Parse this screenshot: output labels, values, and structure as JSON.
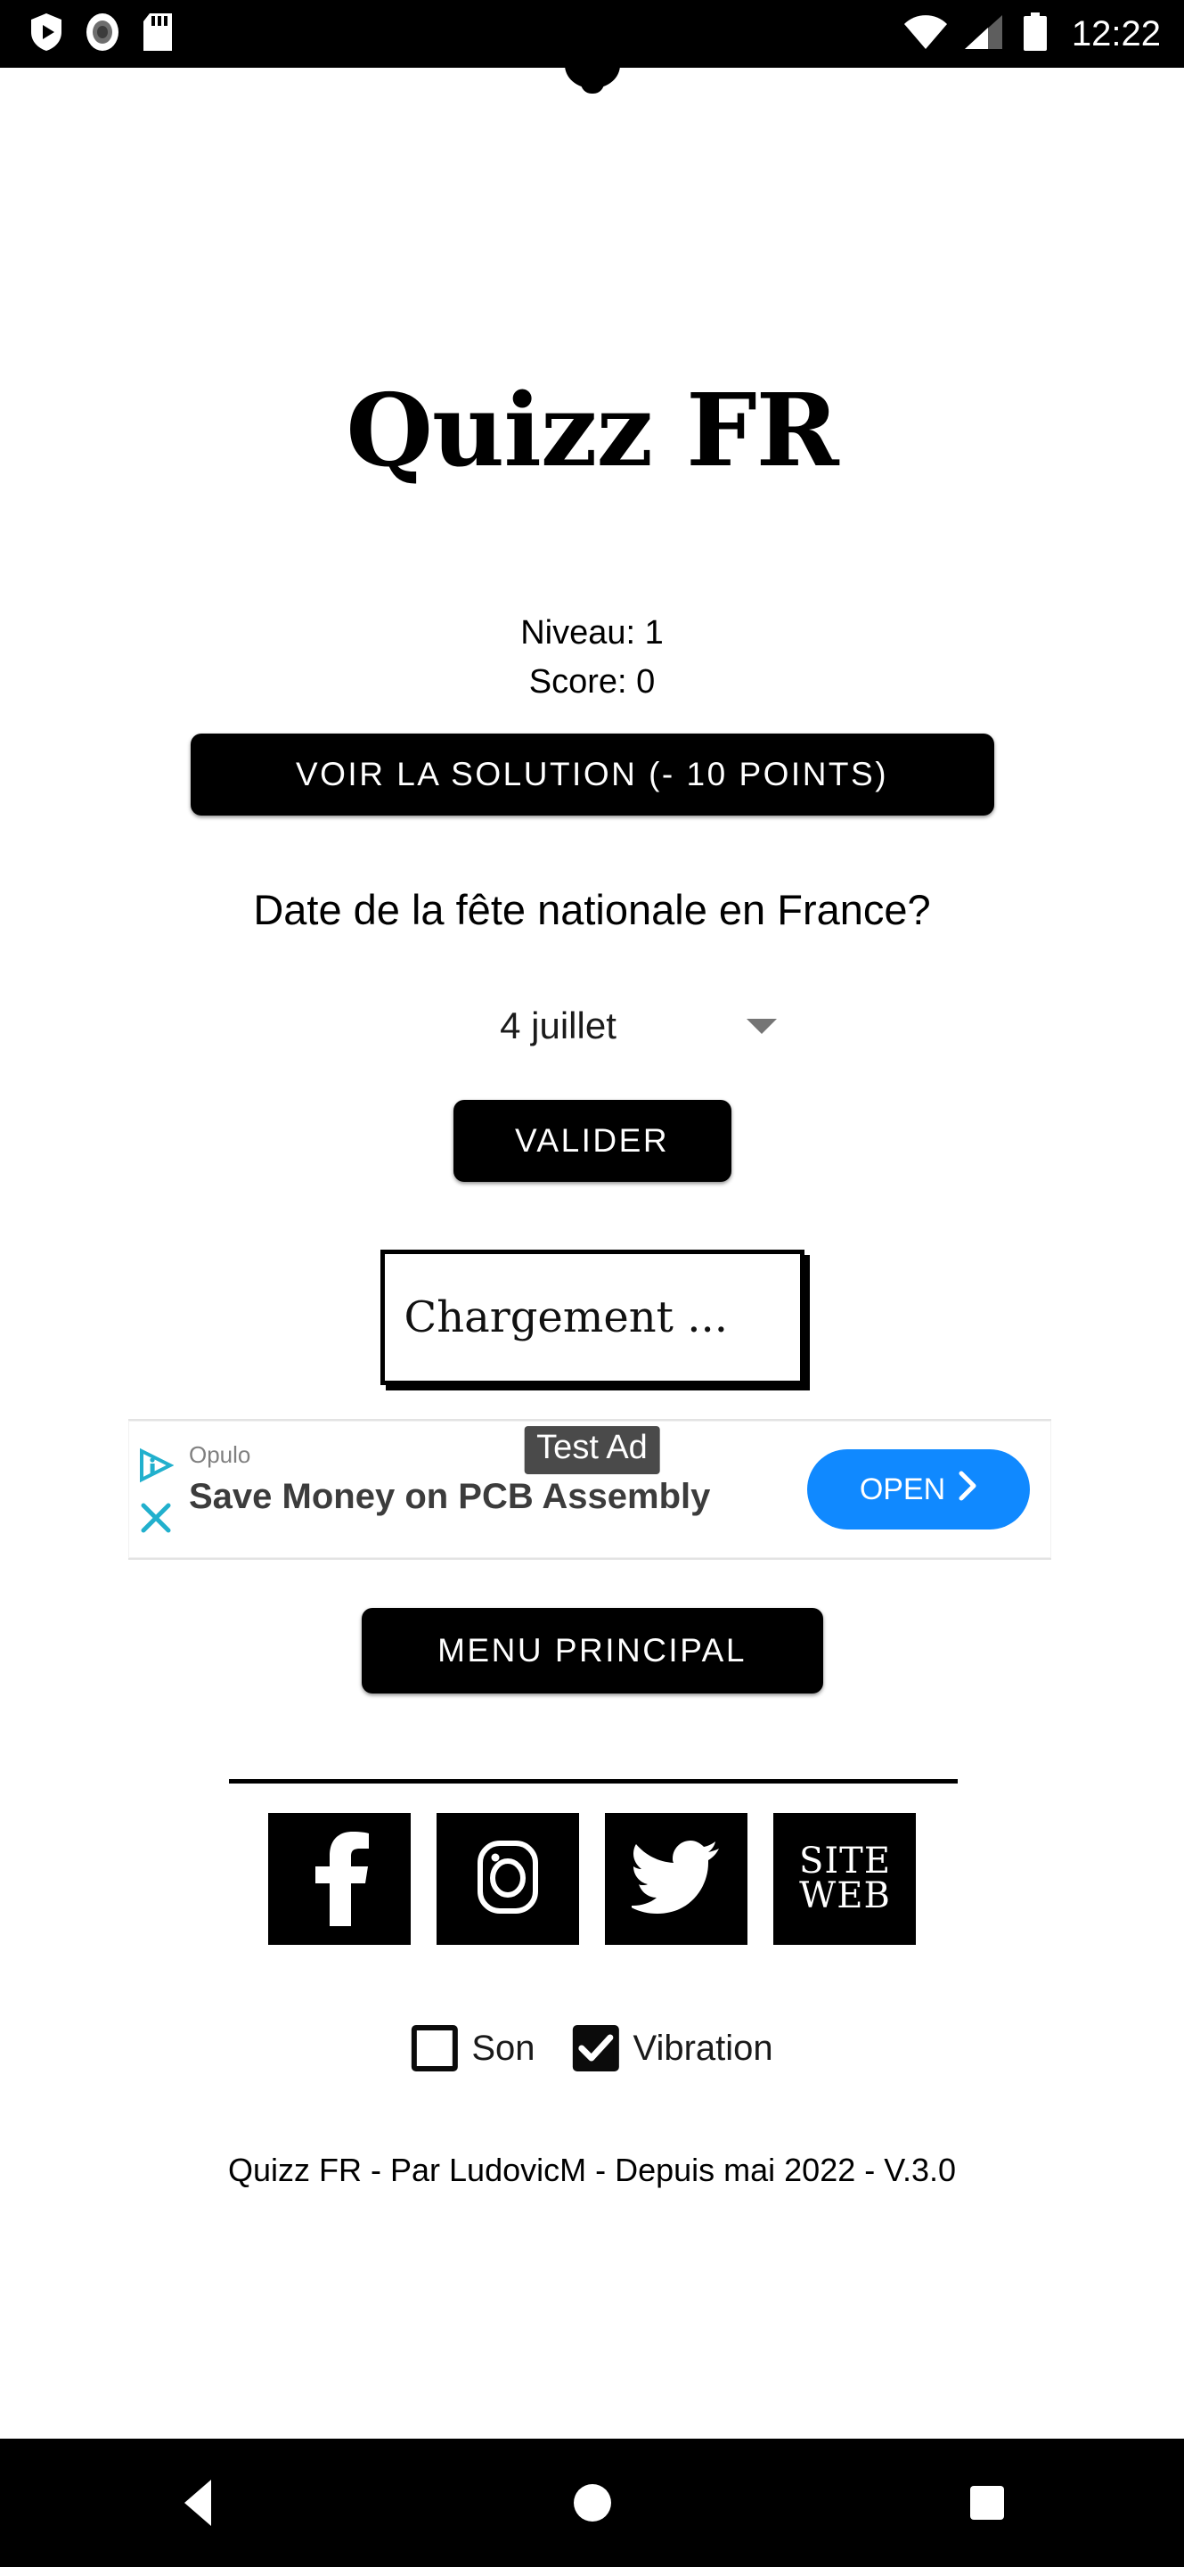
{
  "status_bar": {
    "time": "12:22",
    "icons": [
      "shield-play-icon",
      "camera-record-icon",
      "sd-card-icon",
      "wifi-icon",
      "cellular-signal-icon",
      "battery-icon"
    ]
  },
  "app": {
    "title": "Quizz FR",
    "level_label": "Niveau: 1",
    "score_label": "Score: 0",
    "solution_button": "VOIR LA SOLUTION (- 10 POINTS)",
    "question": "Date de la fête nationale en France?",
    "answer_spinner": {
      "selected": "4 juillet",
      "caret": "chevron-down-icon"
    },
    "validate_button": "VALIDER",
    "loading_text": "Chargement ...",
    "menu_button": "MENU PRINCIPAL",
    "social": [
      {
        "name": "facebook",
        "icon": "facebook-icon",
        "label": ""
      },
      {
        "name": "instagram",
        "icon": "instagram-icon",
        "label": ""
      },
      {
        "name": "twitter",
        "icon": "twitter-icon",
        "label": ""
      },
      {
        "name": "website",
        "icon": "site-web-icon",
        "label_line1": "SITE",
        "label_line2": "WEB"
      }
    ],
    "settings": {
      "sound": {
        "label": "Son",
        "checked": false
      },
      "vibration": {
        "label": "Vibration",
        "checked": true
      }
    },
    "footer": "Quizz FR - Par LudovicM - Depuis mai 2022 - V.3.0"
  },
  "ad": {
    "badge": "Test Ad",
    "advertiser": "Opulo",
    "headline": "Save Money on PCB Assembly",
    "cta": "OPEN",
    "cta_caret": "chevron-right-icon",
    "adchoices_icon": "adchoices-icon",
    "close_icon": "close-icon",
    "accent_color": "#1089ff",
    "icon_color": "#21b0cd"
  },
  "nav_bar": {
    "back": "back-triangle-icon",
    "home": "home-circle-icon",
    "recents": "recents-square-icon"
  },
  "colors": {
    "background": "#ffffff",
    "foreground": "#000000",
    "ad_blue": "#1089ff",
    "ad_teal": "#21b0cd",
    "badge_gray": "#4a4a4a"
  }
}
